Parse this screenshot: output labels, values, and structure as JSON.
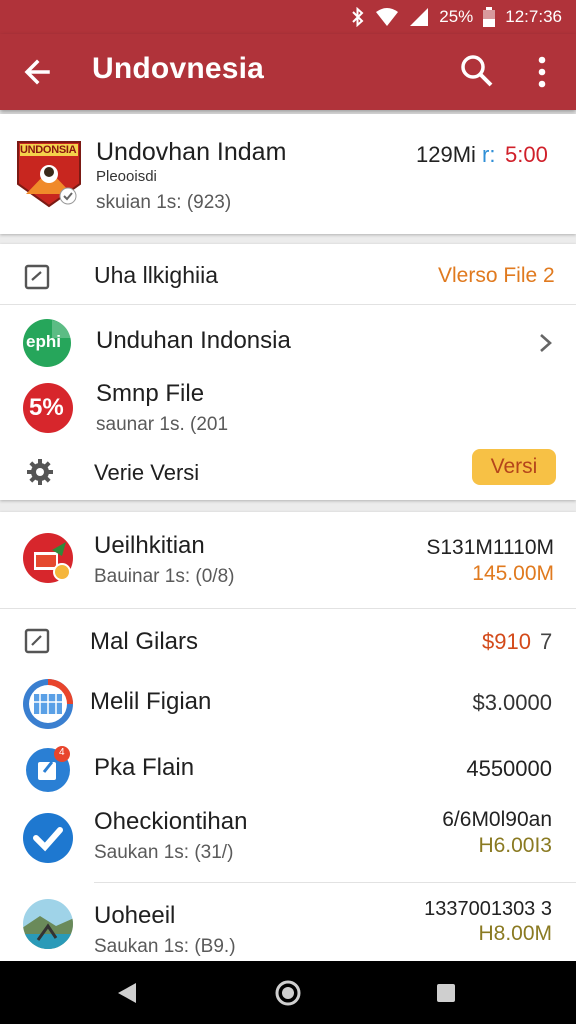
{
  "status_bar": {
    "battery": "25%",
    "time": "12:7:36"
  },
  "app_bar": {
    "title": "Undovnesia"
  },
  "top_card": {
    "badge_text": "UNDONSIA",
    "title": "Undovhan Indam",
    "subtitle": "Pleooisdi",
    "detail": "skuian 1s: (923)",
    "size": "129Mi",
    "size_separator": "r:",
    "time": "5:00"
  },
  "section2": {
    "header_label": "Uha llkighiia",
    "header_value": "Vlerso File 2",
    "item1": {
      "icon_text": "ephi",
      "title": "Unduhan Indonsia"
    },
    "item2": {
      "icon_text": "5%",
      "title": "Smnp File",
      "detail": "saunar 1s. (201"
    },
    "item3": {
      "label": "Verie Versi",
      "button": "Versi"
    }
  },
  "section3": {
    "item1": {
      "title": "Ueilhkitian",
      "detail": "Bauinar 1s: (0/8)",
      "value1": "S131M1110M",
      "value2": "145.00M"
    },
    "header": {
      "label": "Mal Gilars",
      "value_a": "$910",
      "value_b": "7"
    },
    "item2": {
      "title": "Melil Figian",
      "value": "$3.0000"
    },
    "item3": {
      "badge": "4",
      "title": "Pka Flain",
      "value": "4550000"
    },
    "item4": {
      "title": "Oheckiontihan",
      "detail": "Saukan 1s: (31/)",
      "value1": "6/6M0l90an",
      "value2": "H6.00I3"
    },
    "item5": {
      "title": "Uoheeil",
      "detail": "Saukan 1s: (B9.)",
      "value1": "1337001303 3",
      "value2": "H8.00M"
    }
  },
  "colors": {
    "primary": "#b0333a",
    "accent_orange": "#e07a1f",
    "pill_yellow": "#f7c145",
    "red_text": "#d0202a",
    "olive_text": "#8a7a22"
  }
}
